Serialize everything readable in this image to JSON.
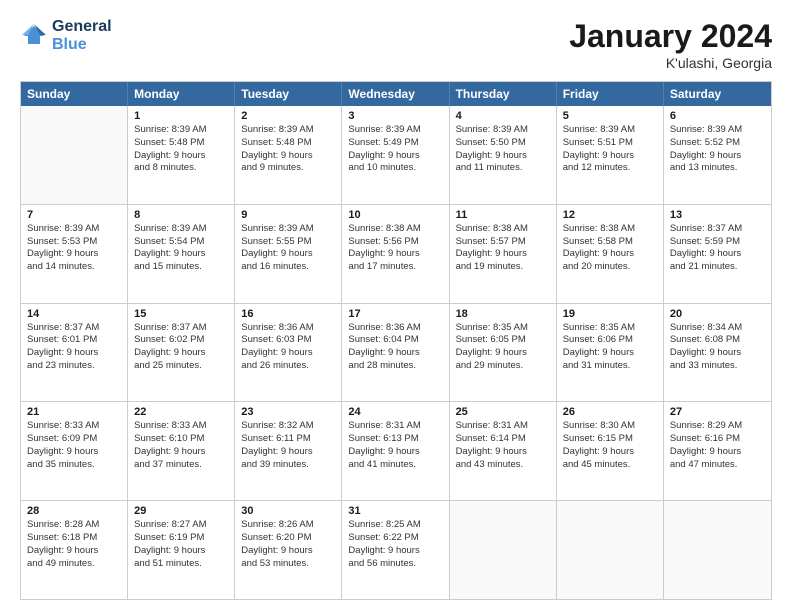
{
  "logo": {
    "line1": "General",
    "line2": "Blue"
  },
  "title": "January 2024",
  "subtitle": "K'ulashi, Georgia",
  "header_days": [
    "Sunday",
    "Monday",
    "Tuesday",
    "Wednesday",
    "Thursday",
    "Friday",
    "Saturday"
  ],
  "rows": [
    [
      {
        "day": "",
        "text": ""
      },
      {
        "day": "1",
        "text": "Sunrise: 8:39 AM\nSunset: 5:48 PM\nDaylight: 9 hours\nand 8 minutes."
      },
      {
        "day": "2",
        "text": "Sunrise: 8:39 AM\nSunset: 5:48 PM\nDaylight: 9 hours\nand 9 minutes."
      },
      {
        "day": "3",
        "text": "Sunrise: 8:39 AM\nSunset: 5:49 PM\nDaylight: 9 hours\nand 10 minutes."
      },
      {
        "day": "4",
        "text": "Sunrise: 8:39 AM\nSunset: 5:50 PM\nDaylight: 9 hours\nand 11 minutes."
      },
      {
        "day": "5",
        "text": "Sunrise: 8:39 AM\nSunset: 5:51 PM\nDaylight: 9 hours\nand 12 minutes."
      },
      {
        "day": "6",
        "text": "Sunrise: 8:39 AM\nSunset: 5:52 PM\nDaylight: 9 hours\nand 13 minutes."
      }
    ],
    [
      {
        "day": "7",
        "text": "Sunrise: 8:39 AM\nSunset: 5:53 PM\nDaylight: 9 hours\nand 14 minutes."
      },
      {
        "day": "8",
        "text": "Sunrise: 8:39 AM\nSunset: 5:54 PM\nDaylight: 9 hours\nand 15 minutes."
      },
      {
        "day": "9",
        "text": "Sunrise: 8:39 AM\nSunset: 5:55 PM\nDaylight: 9 hours\nand 16 minutes."
      },
      {
        "day": "10",
        "text": "Sunrise: 8:38 AM\nSunset: 5:56 PM\nDaylight: 9 hours\nand 17 minutes."
      },
      {
        "day": "11",
        "text": "Sunrise: 8:38 AM\nSunset: 5:57 PM\nDaylight: 9 hours\nand 19 minutes."
      },
      {
        "day": "12",
        "text": "Sunrise: 8:38 AM\nSunset: 5:58 PM\nDaylight: 9 hours\nand 20 minutes."
      },
      {
        "day": "13",
        "text": "Sunrise: 8:37 AM\nSunset: 5:59 PM\nDaylight: 9 hours\nand 21 minutes."
      }
    ],
    [
      {
        "day": "14",
        "text": "Sunrise: 8:37 AM\nSunset: 6:01 PM\nDaylight: 9 hours\nand 23 minutes."
      },
      {
        "day": "15",
        "text": "Sunrise: 8:37 AM\nSunset: 6:02 PM\nDaylight: 9 hours\nand 25 minutes."
      },
      {
        "day": "16",
        "text": "Sunrise: 8:36 AM\nSunset: 6:03 PM\nDaylight: 9 hours\nand 26 minutes."
      },
      {
        "day": "17",
        "text": "Sunrise: 8:36 AM\nSunset: 6:04 PM\nDaylight: 9 hours\nand 28 minutes."
      },
      {
        "day": "18",
        "text": "Sunrise: 8:35 AM\nSunset: 6:05 PM\nDaylight: 9 hours\nand 29 minutes."
      },
      {
        "day": "19",
        "text": "Sunrise: 8:35 AM\nSunset: 6:06 PM\nDaylight: 9 hours\nand 31 minutes."
      },
      {
        "day": "20",
        "text": "Sunrise: 8:34 AM\nSunset: 6:08 PM\nDaylight: 9 hours\nand 33 minutes."
      }
    ],
    [
      {
        "day": "21",
        "text": "Sunrise: 8:33 AM\nSunset: 6:09 PM\nDaylight: 9 hours\nand 35 minutes."
      },
      {
        "day": "22",
        "text": "Sunrise: 8:33 AM\nSunset: 6:10 PM\nDaylight: 9 hours\nand 37 minutes."
      },
      {
        "day": "23",
        "text": "Sunrise: 8:32 AM\nSunset: 6:11 PM\nDaylight: 9 hours\nand 39 minutes."
      },
      {
        "day": "24",
        "text": "Sunrise: 8:31 AM\nSunset: 6:13 PM\nDaylight: 9 hours\nand 41 minutes."
      },
      {
        "day": "25",
        "text": "Sunrise: 8:31 AM\nSunset: 6:14 PM\nDaylight: 9 hours\nand 43 minutes."
      },
      {
        "day": "26",
        "text": "Sunrise: 8:30 AM\nSunset: 6:15 PM\nDaylight: 9 hours\nand 45 minutes."
      },
      {
        "day": "27",
        "text": "Sunrise: 8:29 AM\nSunset: 6:16 PM\nDaylight: 9 hours\nand 47 minutes."
      }
    ],
    [
      {
        "day": "28",
        "text": "Sunrise: 8:28 AM\nSunset: 6:18 PM\nDaylight: 9 hours\nand 49 minutes."
      },
      {
        "day": "29",
        "text": "Sunrise: 8:27 AM\nSunset: 6:19 PM\nDaylight: 9 hours\nand 51 minutes."
      },
      {
        "day": "30",
        "text": "Sunrise: 8:26 AM\nSunset: 6:20 PM\nDaylight: 9 hours\nand 53 minutes."
      },
      {
        "day": "31",
        "text": "Sunrise: 8:25 AM\nSunset: 6:22 PM\nDaylight: 9 hours\nand 56 minutes."
      },
      {
        "day": "",
        "text": ""
      },
      {
        "day": "",
        "text": ""
      },
      {
        "day": "",
        "text": ""
      }
    ]
  ]
}
